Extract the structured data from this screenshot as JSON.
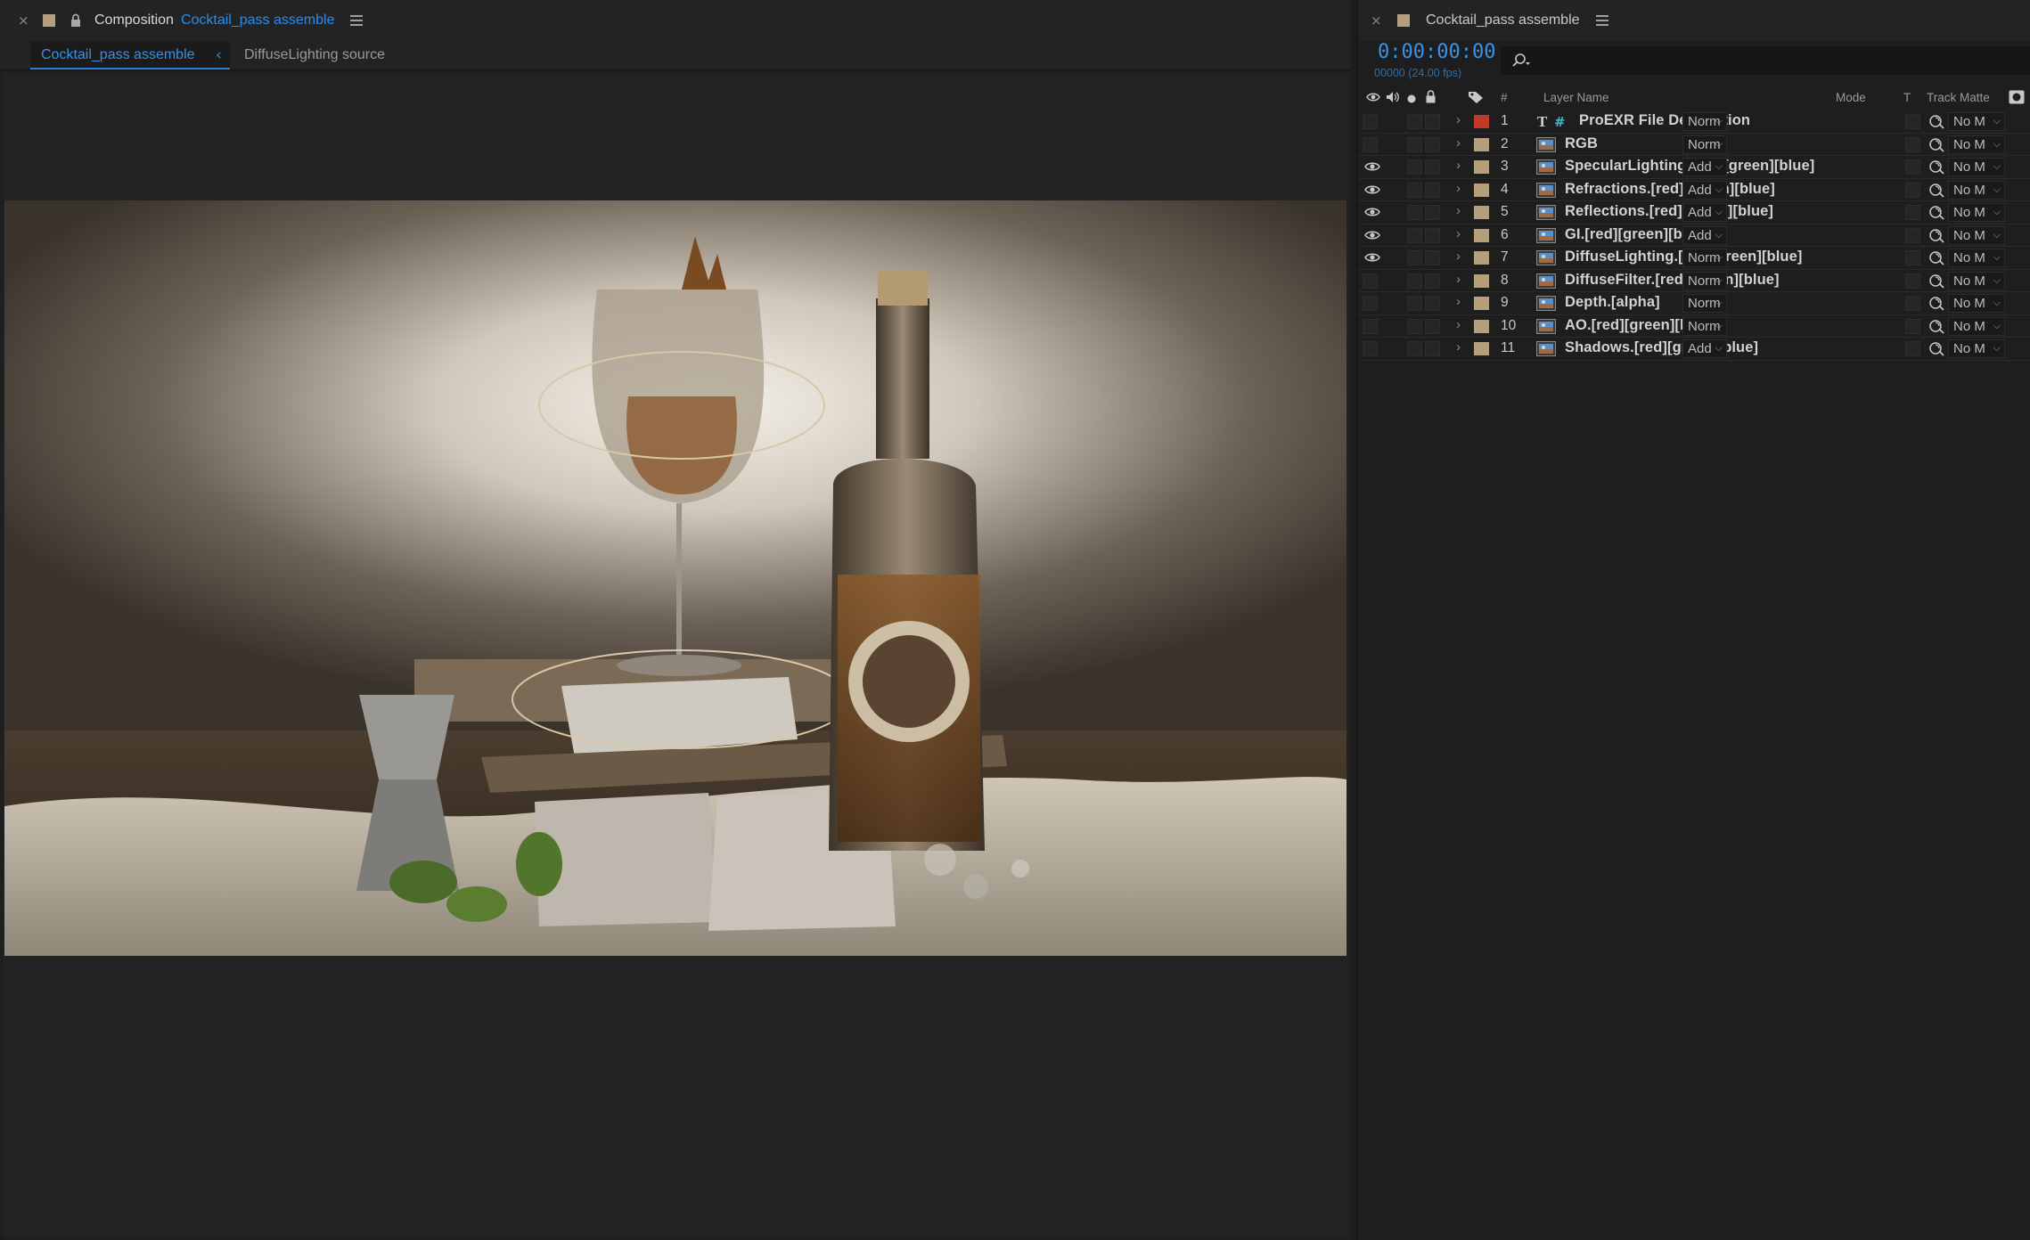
{
  "composition_panel": {
    "close_glyph": "×",
    "label": "Composition",
    "comp_name": "Cocktail_pass assemble",
    "menu_icon": "hamburger-icon",
    "breadcrumbs": [
      "Cocktail_pass assemble",
      "DiffuseLighting source"
    ],
    "breadcrumb_separator": "‹",
    "colors": {
      "accent": "#2d8ceb",
      "swatch": "#b5a07e"
    }
  },
  "timeline_panel": {
    "close_glyph": "×",
    "comp_name": "Cocktail_pass assemble",
    "timecode": "0:00:00:00",
    "frame_info": "00000 (24.00 fps)",
    "search_placeholder": "",
    "columns": {
      "number": "#",
      "layer_name": "Layer Name",
      "mode": "Mode",
      "t": "T",
      "track_matte": "Track Matte"
    },
    "layers": [
      {
        "num": "1",
        "name": "ProEXR File Description",
        "type": "text",
        "label_color": "#c0392b",
        "visible": false,
        "mode": "Norm",
        "matte": "No M"
      },
      {
        "num": "2",
        "name": "RGB",
        "type": "footage",
        "label_color": "#b5a07e",
        "visible": false,
        "mode": "Norm",
        "matte": "No M"
      },
      {
        "num": "3",
        "name": "SpecularLighting.[red][green][blue]",
        "type": "footage",
        "label_color": "#b5a07e",
        "visible": true,
        "mode": "Add",
        "matte": "No M"
      },
      {
        "num": "4",
        "name": "Refractions.[red][green][blue]",
        "type": "footage",
        "label_color": "#b5a07e",
        "visible": true,
        "mode": "Add",
        "matte": "No M"
      },
      {
        "num": "5",
        "name": "Reflections.[red][green][blue]",
        "type": "footage",
        "label_color": "#b5a07e",
        "visible": true,
        "mode": "Add",
        "matte": "No M"
      },
      {
        "num": "6",
        "name": "GI.[red][green][blue]",
        "type": "footage",
        "label_color": "#b5a07e",
        "visible": true,
        "mode": "Add",
        "matte": "No M"
      },
      {
        "num": "7",
        "name": "DiffuseLighting.[red][green][blue]",
        "type": "footage",
        "label_color": "#b5a07e",
        "visible": true,
        "mode": "Norm",
        "matte": "No M"
      },
      {
        "num": "8",
        "name": "DiffuseFilter.[red][green][blue]",
        "type": "footage",
        "label_color": "#b5a07e",
        "visible": false,
        "mode": "Norm",
        "matte": "No M"
      },
      {
        "num": "9",
        "name": "Depth.[alpha]",
        "type": "footage",
        "label_color": "#b5a07e",
        "visible": false,
        "mode": "Norm",
        "matte": "No M"
      },
      {
        "num": "10",
        "name": "AO.[red][green][blue]",
        "type": "footage",
        "label_color": "#b5a07e",
        "visible": false,
        "mode": "Norm",
        "matte": "No M"
      },
      {
        "num": "11",
        "name": "Shadows.[red][green][blue]",
        "type": "footage",
        "label_color": "#b5a07e",
        "visible": false,
        "mode": "Add",
        "matte": "No M"
      }
    ]
  }
}
